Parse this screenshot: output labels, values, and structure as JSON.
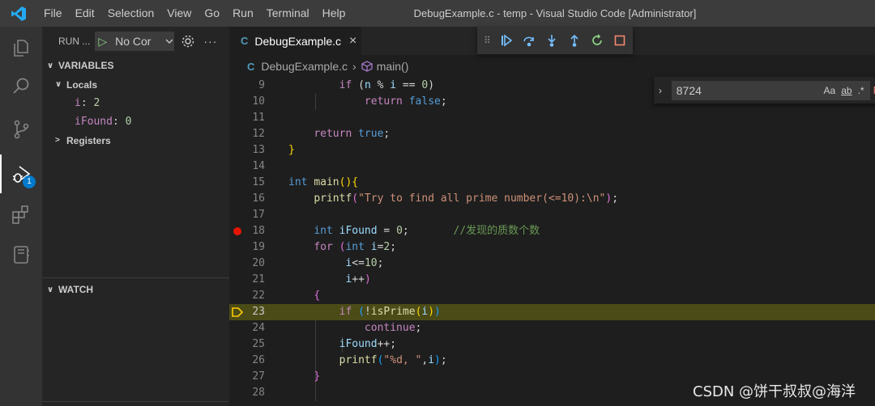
{
  "window": {
    "title": "DebugExample.c - temp - Visual Studio Code [Administrator]",
    "menu": [
      "File",
      "Edit",
      "Selection",
      "View",
      "Go",
      "Run",
      "Terminal",
      "Help"
    ]
  },
  "activity_bar": {
    "items": [
      "explorer-icon",
      "search-icon",
      "source-control-icon",
      "run-debug-icon",
      "extensions-icon",
      "notebook-icon"
    ],
    "debug_badge": "1",
    "accent": "#007acc"
  },
  "sidebar": {
    "run_label": "RUN ...",
    "config_select": "No Cor",
    "variables_title": "VARIABLES",
    "locals_label": "Locals",
    "locals": [
      {
        "name": "i",
        "value": "2"
      },
      {
        "name": "iFound",
        "value": "0"
      }
    ],
    "registers_label": "Registers",
    "watch_title": "WATCH"
  },
  "editor": {
    "tab_icon": "C",
    "tab_label": "DebugExample.c",
    "breadcrumb": {
      "file": "DebugExample.c",
      "symbol": "main()"
    },
    "find": {
      "value": "8724",
      "opt_case": "Aa",
      "opt_word": "ab",
      "opt_regex": ".*",
      "result": "N"
    },
    "breakpoint_line": "18",
    "current_line": "23"
  },
  "code_lines": [
    {
      "n": "9"
    },
    {
      "n": "10"
    },
    {
      "n": "11"
    },
    {
      "n": "12"
    },
    {
      "n": "13"
    },
    {
      "n": "14"
    },
    {
      "n": "15"
    },
    {
      "n": "16"
    },
    {
      "n": "17"
    },
    {
      "n": "18"
    },
    {
      "n": "19"
    },
    {
      "n": "20"
    },
    {
      "n": "21"
    },
    {
      "n": "22"
    },
    {
      "n": "23"
    },
    {
      "n": "24"
    },
    {
      "n": "25"
    },
    {
      "n": "26"
    },
    {
      "n": "27"
    },
    {
      "n": "28"
    }
  ],
  "watermark": "CSDN @饼干叔叔@海洋"
}
